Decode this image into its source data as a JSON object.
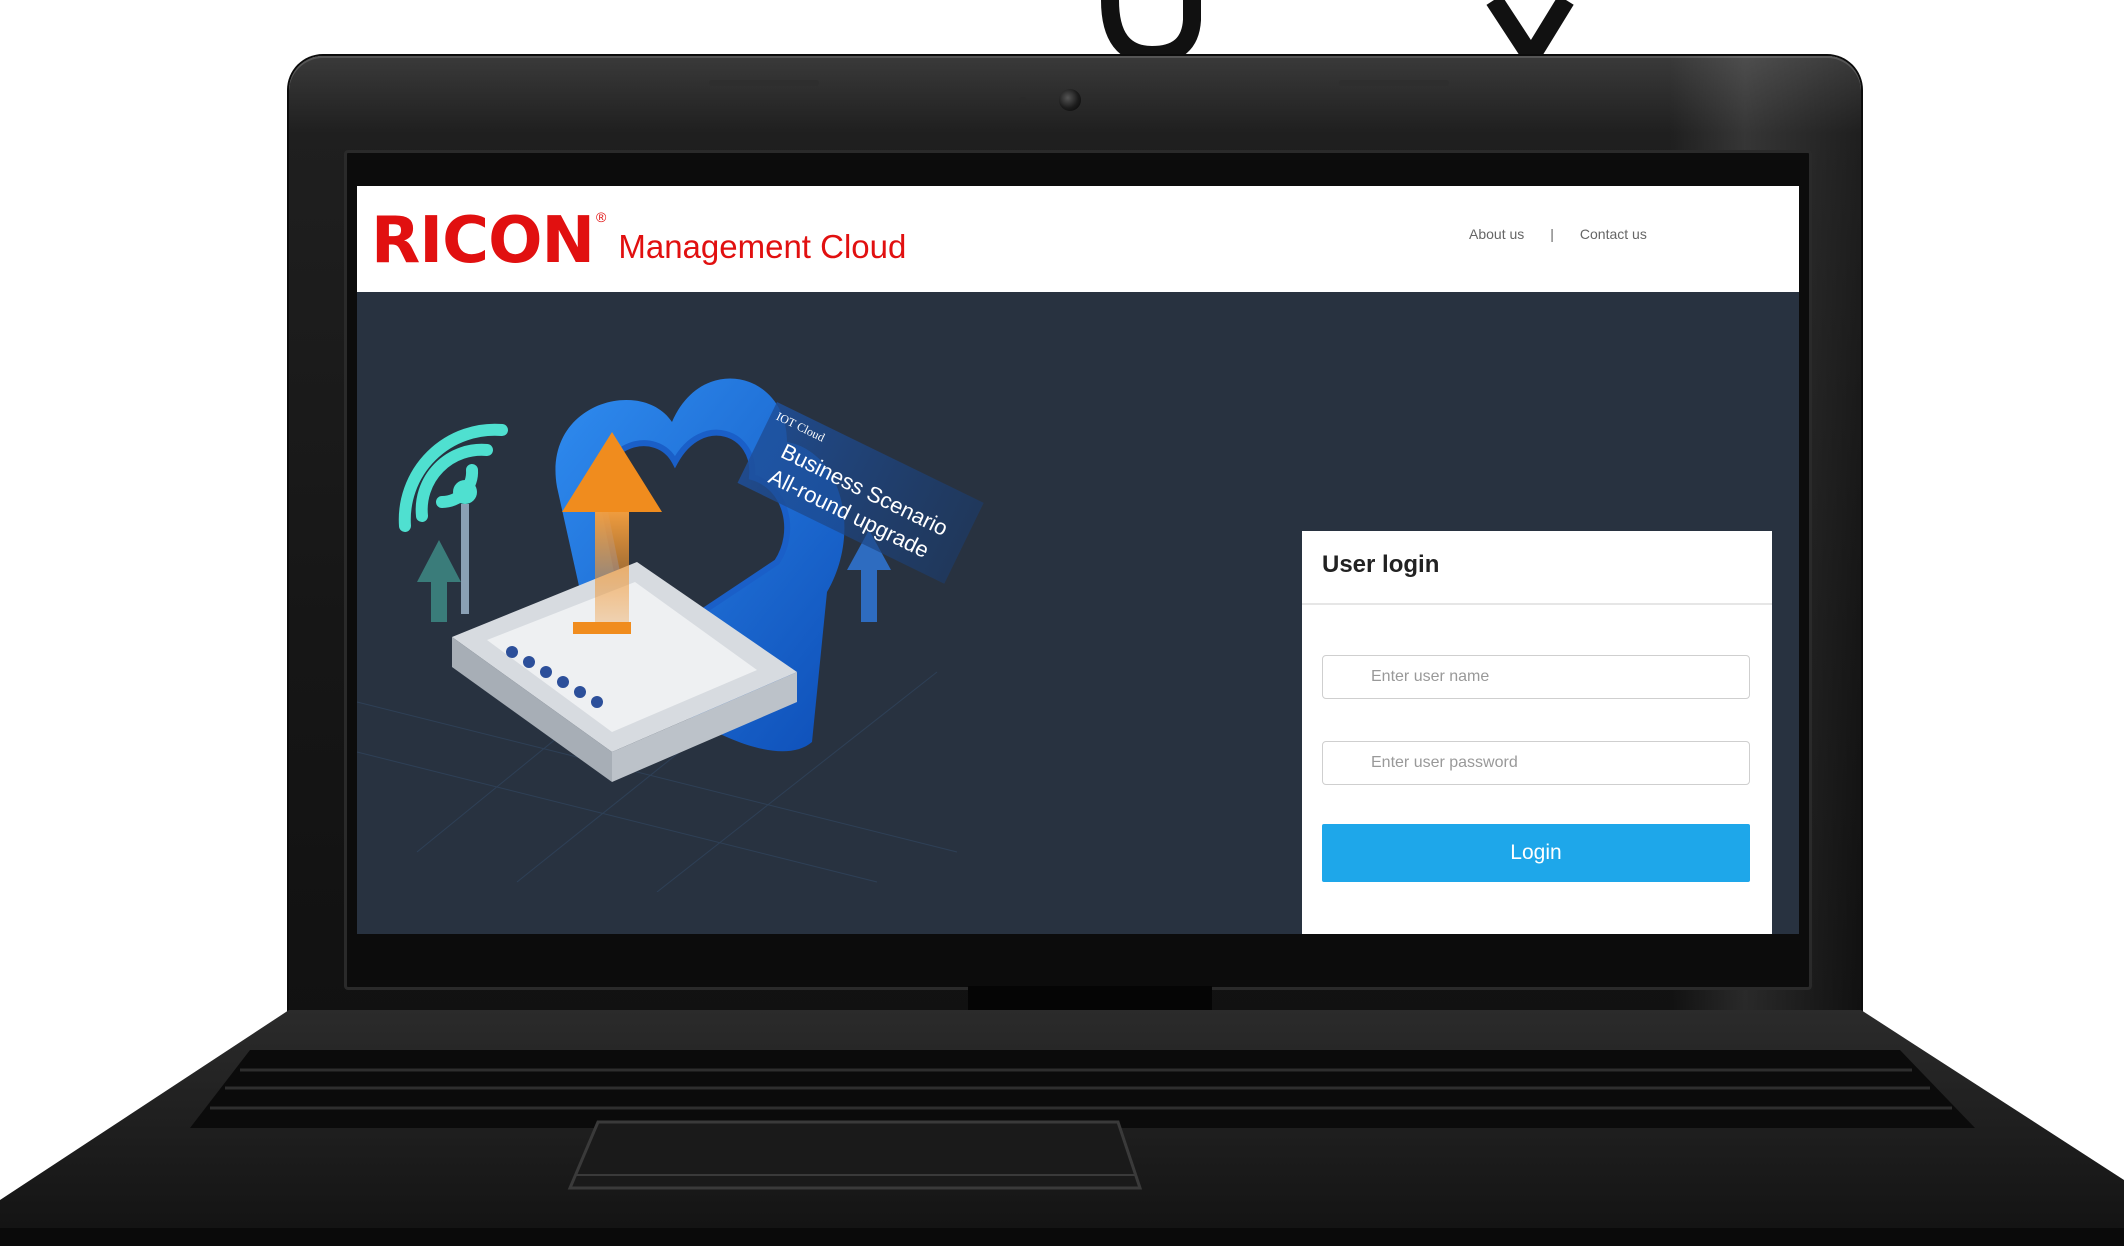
{
  "site": {
    "brand": "RICON",
    "registered_mark": "®",
    "subtitle": "Management Cloud",
    "nav": {
      "about": "About us",
      "separator": "|",
      "contact": "Contact us"
    }
  },
  "illustration": {
    "tag": "IOT Cloud",
    "line1": "Business Scenario",
    "line2": "All-round upgrade"
  },
  "login": {
    "title": "User login",
    "username_placeholder": "Enter user name",
    "password_placeholder": "Enter user password",
    "button_label": "Login"
  },
  "colors": {
    "brand_red": "#e11010",
    "hero_background": "#283240",
    "login_button": "#1ea7ea",
    "wifi_accent": "#4fe0d0",
    "cloud_blue": "#1e78e0",
    "arrow_orange": "#f08c1e"
  }
}
